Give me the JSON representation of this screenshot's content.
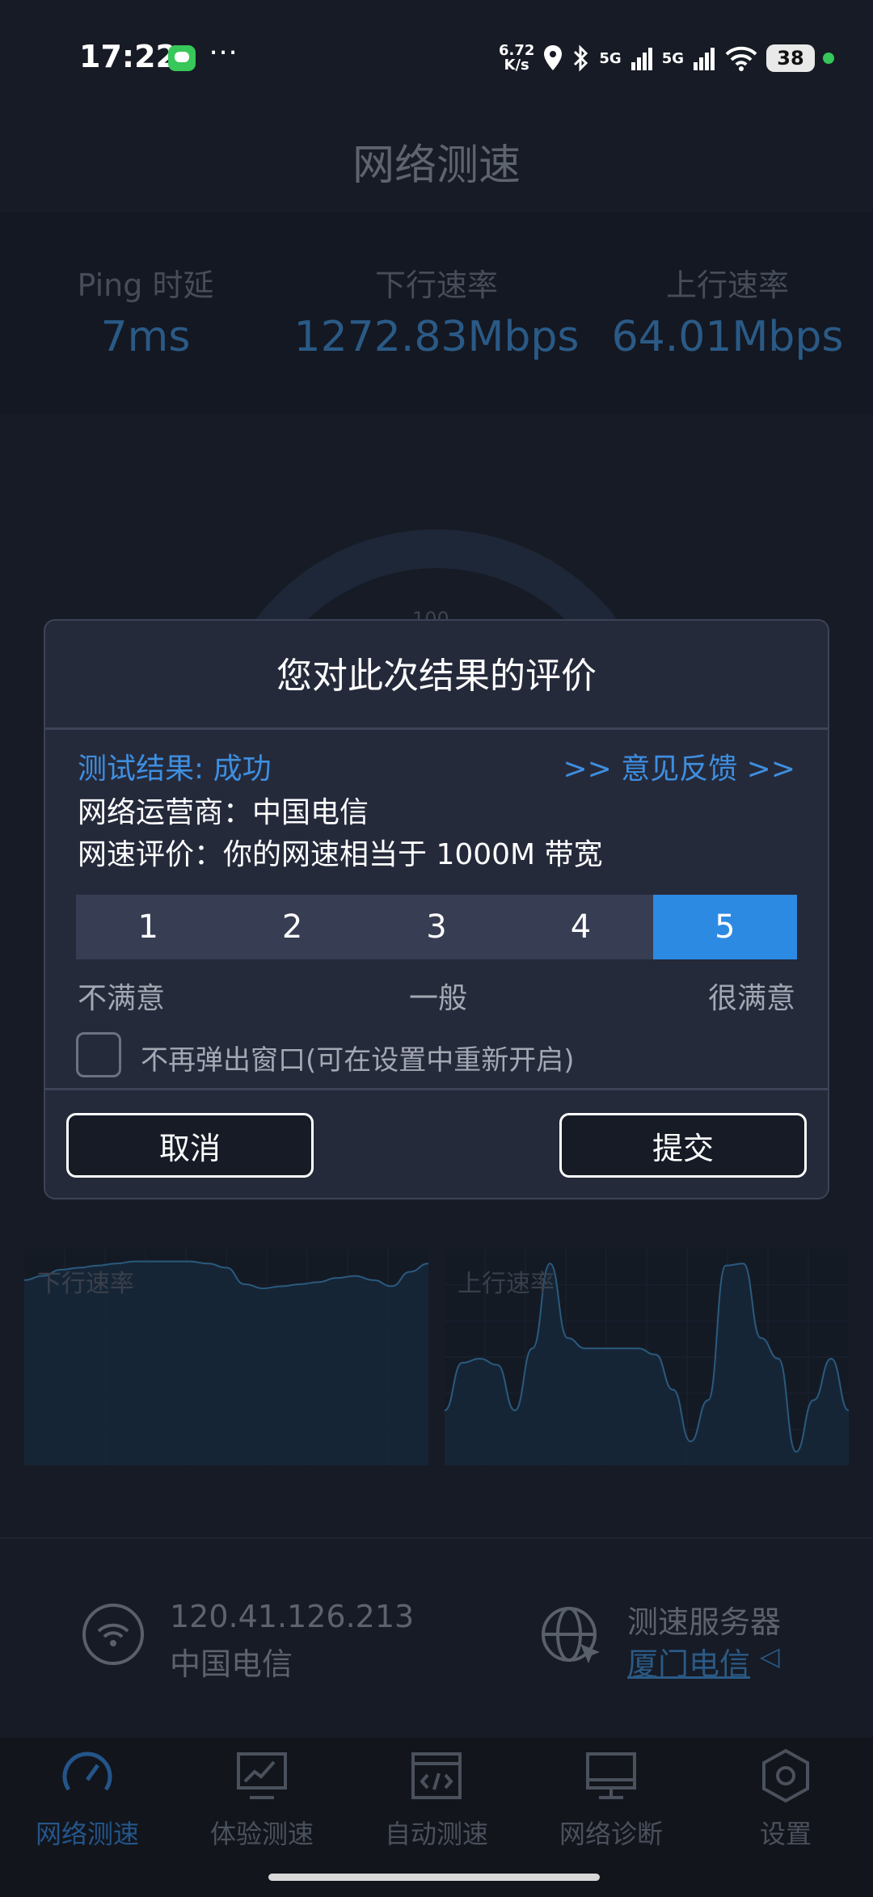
{
  "status_bar": {
    "time": "17:22",
    "net_speed_value": "6.72",
    "net_speed_unit": "K/s",
    "signal_1": "5G",
    "signal_2": "5G",
    "battery": "38"
  },
  "header": {
    "title": "网络测速"
  },
  "stats": {
    "ping_label": "Ping 时延",
    "ping_value": "7ms",
    "download_label": "下行速率",
    "download_value": "1272.83Mbps",
    "upload_label": "上行速率",
    "upload_value": "64.01Mbps"
  },
  "gauge": {
    "top_tick": "100"
  },
  "charts": {
    "download_label": "下行速率",
    "upload_label": "上行速率"
  },
  "chart_data": [
    {
      "type": "area",
      "title": "下行速率",
      "xlabel": "",
      "ylabel": "",
      "y": [
        0.88,
        0.9,
        0.93,
        0.94,
        0.95,
        0.96,
        0.97,
        0.97,
        0.97,
        0.97,
        0.96,
        0.94,
        0.86,
        0.84,
        0.85,
        0.86,
        0.87,
        0.89,
        0.9,
        0.88,
        0.85,
        0.92,
        0.96
      ]
    },
    {
      "type": "area",
      "title": "上行速率",
      "xlabel": "",
      "ylabel": "",
      "y": [
        0.25,
        0.48,
        0.5,
        0.47,
        0.25,
        0.55,
        0.96,
        0.6,
        0.55,
        0.55,
        0.55,
        0.55,
        0.52,
        0.35,
        0.1,
        0.3,
        0.95,
        0.96,
        0.6,
        0.5,
        0.05,
        0.3,
        0.5,
        0.25
      ]
    }
  ],
  "bottom_info": {
    "ip": "120.41.126.213",
    "isp": "中国电信",
    "server_title": "测速服务器",
    "server_name": "厦门电信",
    "server_arrow": "◁"
  },
  "dialog": {
    "title": "您对此次结果的评价",
    "result_status": "测试结果: 成功",
    "feedback_link": ">> 意见反馈 >>",
    "isp_line": "网络运营商：中国电信",
    "evaluation_line": "网速评价：你的网速相当于 1000M 带宽",
    "ratings": [
      "1",
      "2",
      "3",
      "4",
      "5"
    ],
    "selected_rating": "5",
    "scale_low": "不满意",
    "scale_mid": "一般",
    "scale_high": "很满意",
    "checkbox_label": "不再弹出窗口(可在设置中重新开启)",
    "checkbox_checked": false,
    "cancel_label": "取消",
    "submit_label": "提交"
  },
  "tabs": [
    {
      "label": "网络测速",
      "icon": "speedometer-icon",
      "active": true
    },
    {
      "label": "体验测速",
      "icon": "chart-monitor-icon",
      "active": false
    },
    {
      "label": "自动测速",
      "icon": "code-window-icon",
      "active": false
    },
    {
      "label": "网络诊断",
      "icon": "monitor-icon",
      "active": false
    },
    {
      "label": "设置",
      "icon": "settings-hexagon-icon",
      "active": false
    }
  ],
  "colors": {
    "background": "#171b25",
    "accent_blue": "#2d8ae2",
    "link_blue": "#3e8fe0",
    "dialog_bg": "#252a3b",
    "status_green": "#34c759"
  }
}
